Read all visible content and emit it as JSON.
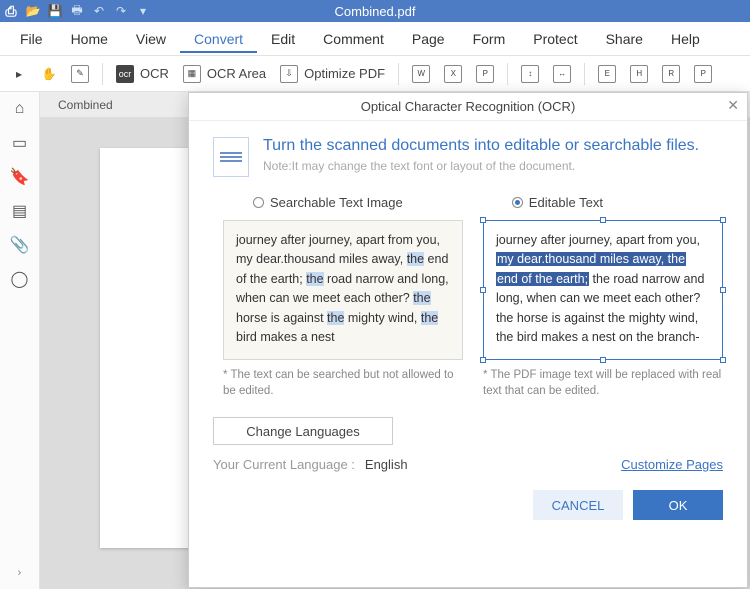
{
  "titlebar": {
    "document_title": "Combined.pdf"
  },
  "menubar": {
    "items": [
      "File",
      "Home",
      "View",
      "Convert",
      "Edit",
      "Comment",
      "Page",
      "Form",
      "Protect",
      "Share",
      "Help"
    ],
    "active_index": 3
  },
  "toolbar": {
    "ocr": "OCR",
    "ocr_area": "OCR Area",
    "optimize": "Optimize PDF",
    "export_labels": [
      "W",
      "X",
      "P"
    ],
    "batch_labels": [
      "↕",
      "↔"
    ],
    "ext_labels": [
      "E",
      "H",
      "R",
      "P"
    ]
  },
  "tabstrip": {
    "tab0": "Combined"
  },
  "dialog": {
    "title": "Optical Character Recognition (OCR)",
    "headline": "Turn the scanned documents into editable or searchable files.",
    "note": "Note:It may change the text font or layout of the document.",
    "option_searchable": "Searchable Text Image",
    "option_editable": "Editable Text",
    "selected_option": "editable",
    "preview_left": {
      "text_parts": {
        "p1": "journey after journey, apart from you, my dear.thousand miles away, ",
        "hl1": "the",
        "p2": " end of the earth; ",
        "hl2": "the",
        "p3": " road narrow and long, when can we meet each other? ",
        "hl3": "the",
        "p4": " horse is against ",
        "hl4": "the",
        "p5": " mighty wind, ",
        "hl5": "the",
        "p6": " bird makes a nest"
      },
      "caption": "* The text can be searched but not allowed to be edited."
    },
    "preview_right": {
      "line1": "journey after journey, apart from you,",
      "sel1": "my dear.thousand miles away, the",
      "sel2": "end of the earth;",
      "line2_rest": " the road narrow and",
      "line3": "long, when can we meet each other?",
      "line4": "the horse is against the mighty wind,",
      "line5": "the bird makes a nest on the branch-",
      "caption": "* The PDF image text will be replaced with real text that can be edited."
    },
    "change_languages": "Change Languages",
    "current_lang_label": "Your Current Language :",
    "current_lang": "English",
    "customize_pages": "Customize Pages",
    "cancel": "CANCEL",
    "ok": "OK"
  }
}
